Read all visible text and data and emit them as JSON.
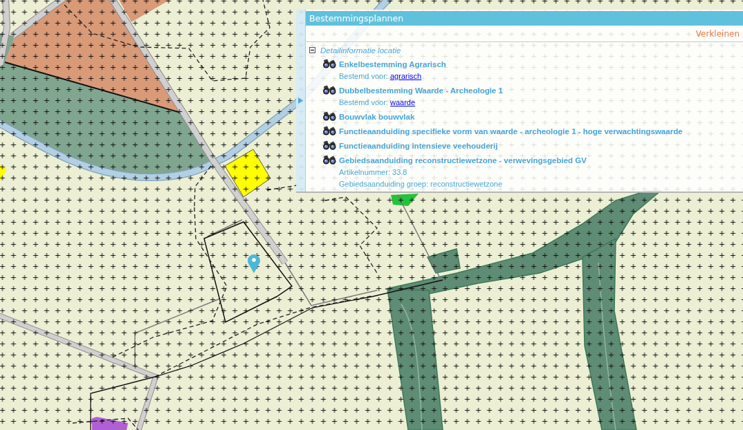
{
  "panel": {
    "title": "Bestemmingsplannen",
    "shrink_link": "Verkleinen",
    "tree": {
      "label": "Detailinformatie locatie",
      "expanded": true,
      "children": [
        {
          "title": "Enkelbestemming Agrarisch",
          "details": [
            {
              "kind": "link",
              "label": "Bestemd voor:",
              "link": "agrarisch"
            }
          ]
        },
        {
          "title": "Dubbelbestemming Waarde - Archeologie 1",
          "details": [
            {
              "kind": "link",
              "label": "Bestemd voor:",
              "link": "waarde"
            }
          ]
        },
        {
          "title": "Bouwvlak bouwvlak"
        },
        {
          "title": "Functieaanduiding specifieke vorm van waarde - archeologie 1 - hoge verwachtingswaarde"
        },
        {
          "title": "Functieaanduiding intensieve veehouderij"
        },
        {
          "title": "Gebiedsaanduiding reconstructiewetzone - verwevingsgebied GV",
          "details": [
            {
              "kind": "text",
              "text": "Artikelnummer: 33.8"
            },
            {
              "kind": "text",
              "text": "Gebiedsaanduiding groep: reconstructiewetzone"
            }
          ]
        }
      ]
    }
  }
}
